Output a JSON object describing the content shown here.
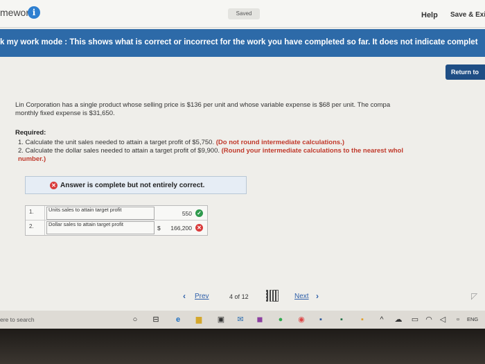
{
  "header": {
    "app_title": "mework",
    "saved_label": "Saved",
    "help_label": "Help",
    "save_exit_label": "Save & Exi"
  },
  "banner": {
    "mode_label": "k my work mode :",
    "message": "This shows what is correct or incorrect for the work you have completed so far. It does not indicate complet"
  },
  "return_button": {
    "label": "Return to"
  },
  "problem": {
    "line1": "Lin Corporation has a single product whose selling price is $136 per unit and whose variable expense is $68 per unit. The compa",
    "line2": "monthly fixed expense is $31,650."
  },
  "required": {
    "label": "Required:",
    "item1_text": "1. Calculate the unit sales needed to attain a target profit of $5,750.",
    "item1_note": "(Do not round intermediate calculations.)",
    "item2_text": "2. Calculate the dollar sales needed to attain a target profit of $9,900.",
    "item2_note": "(Round your intermediate calculations to the nearest whol",
    "item2_note_cont": "number.)"
  },
  "answer_status": {
    "text": "Answer is complete but not entirely correct."
  },
  "answers": [
    {
      "num": "1.",
      "label": "Units sales to attain target profit",
      "prefix": "",
      "value": "550",
      "status": "correct"
    },
    {
      "num": "2.",
      "label": "Dollar sales to attain target profit",
      "prefix": "$",
      "value": "166,200",
      "status": "incorrect"
    }
  ],
  "pager": {
    "prev_label": "Prev",
    "current": "4",
    "of_label": "of",
    "total": "12",
    "next_label": "Next"
  },
  "taskbar": {
    "search_text": "ere to search",
    "lang": "ENG"
  },
  "colors": {
    "banner": "#2d6aa8",
    "correct": "#2f9a4d",
    "incorrect": "#d93b3b",
    "note_red": "#c0392b",
    "link": "#2d5ea8"
  }
}
